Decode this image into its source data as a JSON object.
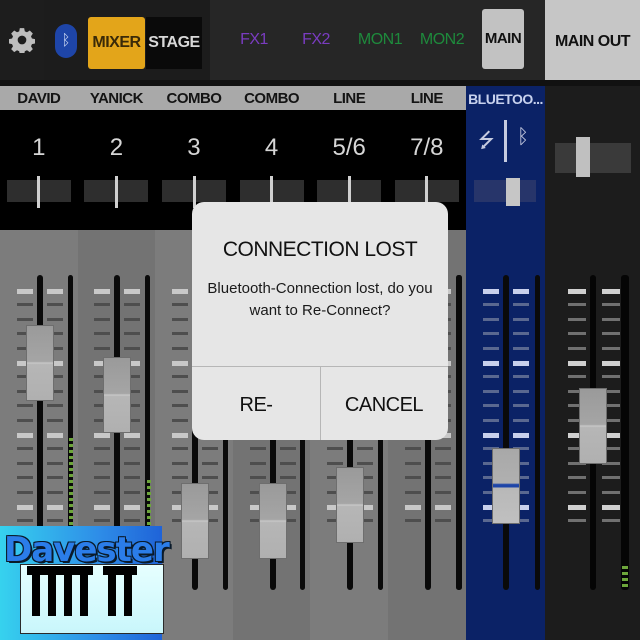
{
  "topbar": {
    "settings_icon": "gear-icon",
    "bluetooth_icon": "bluetooth-icon",
    "modes": [
      {
        "label": "MIXER",
        "active": true
      },
      {
        "label": "STAGE",
        "active": false
      }
    ],
    "buses": [
      {
        "label": "FX1",
        "color": "#7a3cc0"
      },
      {
        "label": "FX2",
        "color": "#7a3cc0"
      },
      {
        "label": "MON1",
        "color": "#1e8a3c"
      },
      {
        "label": "MON2",
        "color": "#1e8a3c"
      },
      {
        "label": "MAIN",
        "color": "#111111",
        "active": true
      }
    ],
    "main_out_label": "MAIN OUT"
  },
  "channels": [
    {
      "name": "DAVID",
      "number": "1",
      "fader": 0.72
    },
    {
      "name": "YANICK",
      "number": "2",
      "fader": 0.62
    },
    {
      "name": "COMBO",
      "number": "3",
      "fader": 0.22
    },
    {
      "name": "COMBO",
      "number": "4",
      "fader": 0.22
    },
    {
      "name": "LINE",
      "number": "5/6",
      "fader": 0.27
    },
    {
      "name": "LINE",
      "number": "7/8",
      "fader": 0.92
    }
  ],
  "bluetooth_channel": {
    "name": "BLUETOO...",
    "usb_icon": "usb-icon",
    "bt_icon": "bluetooth-icon",
    "fader": 0.33
  },
  "main_out": {
    "fader": 0.52
  },
  "dialog": {
    "title": "CONNECTION LOST",
    "message": "Bluetooth-Connection lost, do you want to Re-Connect?",
    "buttons": [
      "RE-CONNECT",
      "CANCEL"
    ]
  },
  "watermark": {
    "text": "Davester"
  },
  "colors": {
    "accent": "#e3a51a",
    "bluetooth_strip": "#0b2266",
    "fx": "#7a3cc0",
    "mon": "#1e8a3c"
  }
}
